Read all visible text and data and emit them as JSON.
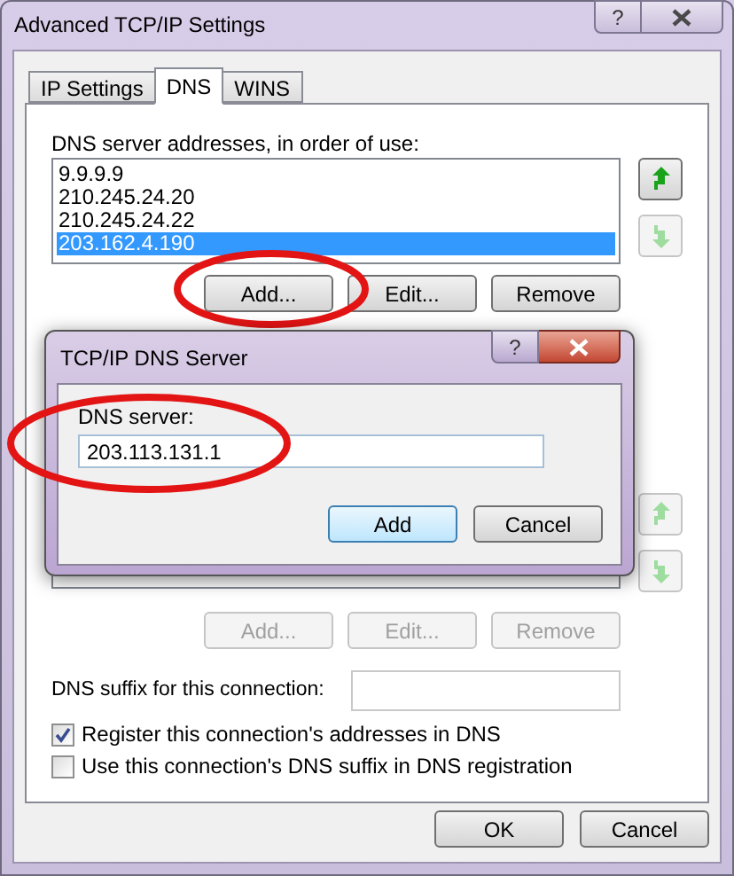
{
  "window": {
    "title": "Advanced TCP/IP Settings",
    "help": "?"
  },
  "tabs": [
    {
      "label": "IP Settings",
      "selected": false
    },
    {
      "label": "DNS",
      "selected": true
    },
    {
      "label": "WINS",
      "selected": false
    }
  ],
  "dns_servers": {
    "label": "DNS server addresses, in order of use:",
    "addresses": [
      {
        "text": "9.9.9.9",
        "selected": false
      },
      {
        "text": "210.245.24.20",
        "selected": false
      },
      {
        "text": "210.245.24.22",
        "selected": false
      },
      {
        "text": "203.162.4.190",
        "selected": true
      }
    ],
    "move_buttons": [
      {
        "kind": "up",
        "disabled": false
      },
      {
        "kind": "down",
        "disabled": true
      }
    ],
    "buttons": [
      {
        "label": "Add...",
        "disabled": false
      },
      {
        "label": "Edit...",
        "disabled": false
      },
      {
        "label": "Remove",
        "disabled": false
      }
    ]
  },
  "suffixes": {
    "move_buttons": [
      {
        "kind": "up",
        "disabled": true
      },
      {
        "kind": "down",
        "disabled": true
      }
    ],
    "buttons": [
      {
        "label": "Add...",
        "disabled": true
      },
      {
        "label": "Edit...",
        "disabled": true
      },
      {
        "label": "Remove",
        "disabled": true
      }
    ]
  },
  "dns_suffix": {
    "label": "DNS suffix for this connection:"
  },
  "checkboxes": [
    {
      "label": "Register this connection's addresses in DNS",
      "checked": true
    },
    {
      "label": "Use this connection's DNS suffix in DNS registration",
      "checked": false
    }
  ],
  "footer_buttons": [
    "OK",
    "Cancel"
  ],
  "dialog": {
    "title": "TCP/IP DNS Server",
    "help": "?",
    "field_label": "DNS server:",
    "value": "203.113.131.1",
    "buttons": [
      {
        "label": "Add",
        "default": true
      },
      {
        "label": "Cancel",
        "default": false
      }
    ]
  }
}
